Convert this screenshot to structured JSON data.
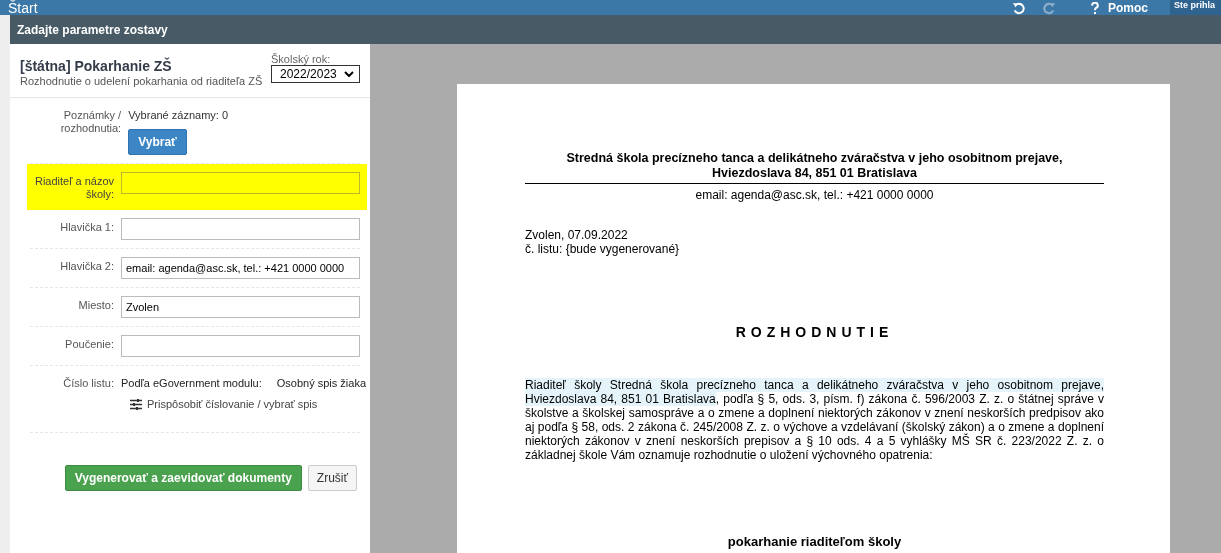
{
  "topbar": {
    "title": "Štart",
    "undo_disabled": false,
    "redo_disabled": true,
    "help": "Pomoc",
    "user": "Ste prihla"
  },
  "dialog": {
    "title": "Zadajte parametre zostavy",
    "report_title": "[štátna] Pokarhanie ZŠ",
    "report_subtitle": "Rozhodnutie o udelení pokarhania od riaditeľa ZŠ",
    "year_label": "Školský rok:",
    "year_value": "2022/2023",
    "rows": [
      {
        "kind": "picker",
        "label": "Poznámky / rozhodnutia:",
        "value": "Vybrané záznamy: 0",
        "button": "Vybrať",
        "highlighted": false
      },
      {
        "kind": "input",
        "label": "Riaditeľ a názov školy:",
        "value": "",
        "highlighted": true
      },
      {
        "kind": "input",
        "label": "Hlavička 1:",
        "value": "",
        "highlighted": false
      },
      {
        "kind": "input",
        "label": "Hlavička 2:",
        "value": "email: agenda@asc.sk, tel.: +421 0000 0000",
        "highlighted": false
      },
      {
        "kind": "input",
        "label": "Miesto:",
        "value": "Zvolen",
        "highlighted": false
      },
      {
        "kind": "input",
        "label": "Poučenie:",
        "value": "",
        "highlighted": false
      },
      {
        "kind": "numbering",
        "label": "Číslo listu:",
        "value": "Podľa eGovernment modulu:",
        "value_2": "Osobný spis žiaka",
        "link": "Prispôsobiť číslovanie / vybrať spis",
        "highlighted": false
      }
    ],
    "primary_button": "Vygenerovať a zaevidovať dokumenty",
    "cancel_button": "Zrušiť"
  },
  "document": {
    "header_lines": [
      "Stredná škola precízneho tanca a delikátneho zváračstva v jeho osobitnom prejave,",
      "Hviezdoslava 84, 851 01 Bratislava"
    ],
    "contact": "email: agenda@asc.sk, tel.: +421 0000 0000",
    "place_date": "Zvolen, 07.09.2022",
    "letter_no": "č. listu: {bude vygenerované}",
    "heading": "ROZHODNUTIE",
    "paragraph_highlighted": "Riaditeľ školy Stredná škola precízneho tanca a delikátneho zváračstva v jeho osobitnom prejave, Hviezdoslava 84, 851 01 Bratislava",
    "paragraph_rest": ", podľa § 5, ods. 3, písm. f) zákona č. 596/2003 Z. z. o štátnej správe v školstve a školskej samospráve a o zmene a doplnení niektorých zákonov v znení neskorších predpisov ako aj podľa § 58, ods. 2 zákona č. 245/2008 Z. z. o výchove a vzdelávaní (školský zákon) a o zmene a doplnení niektorých zákonov v znení neskorších prepisov a § 10 ods. 4 a 5 vyhlášky MŠ SR č. 223/2022 Z. z. o základnej škole Vám oznamuje rozhodnutie o uložení výchovného opatrenia:",
    "measure": "pokarhanie riaditeľom školy"
  }
}
